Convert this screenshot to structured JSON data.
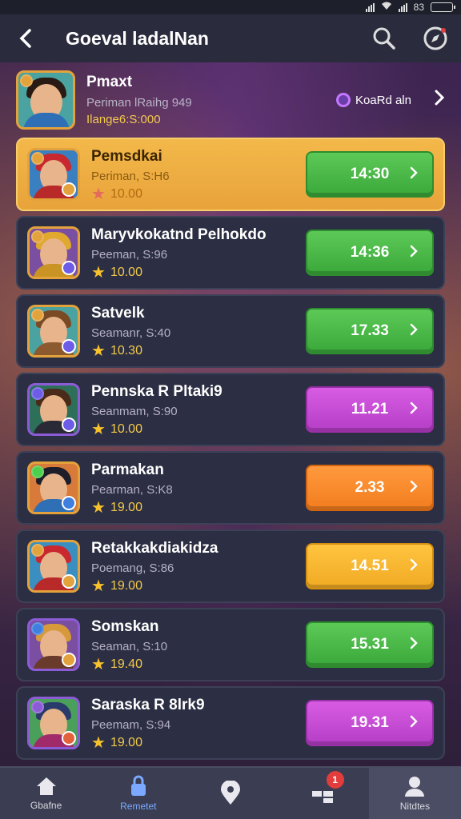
{
  "status": {
    "battery_label": "83"
  },
  "header": {
    "title": "Goeval ladalNan",
    "back_icon": "back-arrow-icon",
    "search_icon": "search-icon",
    "settings_icon": "compass-icon"
  },
  "featured": {
    "name": "Pmaxt",
    "subtitle": "Periman  lRaihg 949",
    "price": "Ilange6:S:000",
    "tag_label": "KoaRd aln"
  },
  "items": [
    {
      "name": "Pemsdkai",
      "subtitle": "Periman, S:H6",
      "rating": "10.00",
      "button": "14:30",
      "button_color": "#4cbb48",
      "highlight": true
    },
    {
      "name": "Maryvkokatnd Pelhokdo",
      "subtitle": "Peeman, S:96",
      "rating": "10.00",
      "button": "14:36",
      "button_color": "#4cbb48",
      "highlight": false
    },
    {
      "name": "Satvelk",
      "subtitle": "Seamanr, S:40",
      "rating": "10.30",
      "button": "17.33",
      "button_color": "#4cbb48",
      "highlight": false
    },
    {
      "name": "Pennska R Pltaki9",
      "subtitle": "Seanmam, S:90",
      "rating": "10.00",
      "button": "11.21",
      "button_color": "#c64dd6",
      "highlight": false
    },
    {
      "name": "Parmakan",
      "subtitle": "Pearman, S:K8",
      "rating": "19.00",
      "button": "2.33",
      "button_color": "#f88a2c",
      "highlight": false
    },
    {
      "name": "Retakkakdiakidza",
      "subtitle": "Poemang, S:86",
      "rating": "19.00",
      "button": "14.51",
      "button_color": "#f8b731",
      "highlight": false
    },
    {
      "name": "Somskan",
      "subtitle": "Seaman, S:10",
      "rating": "19.40",
      "button": "15.31",
      "button_color": "#4cbb48",
      "highlight": false
    },
    {
      "name": "Saraska R 8lrk9",
      "subtitle": "Peemam, S:94",
      "rating": "19.00",
      "button": "19.31",
      "button_color": "#c64dd6",
      "highlight": false
    }
  ],
  "nav": [
    {
      "label": "Gbafne",
      "icon": "home-icon"
    },
    {
      "label": "Remetet",
      "icon": "lock-icon",
      "active": true
    },
    {
      "label": "",
      "icon": "map-pin-icon"
    },
    {
      "label": "",
      "icon": "grid-icon",
      "badge": "1"
    },
    {
      "label": "Nitdtes",
      "icon": "user-icon"
    }
  ]
}
